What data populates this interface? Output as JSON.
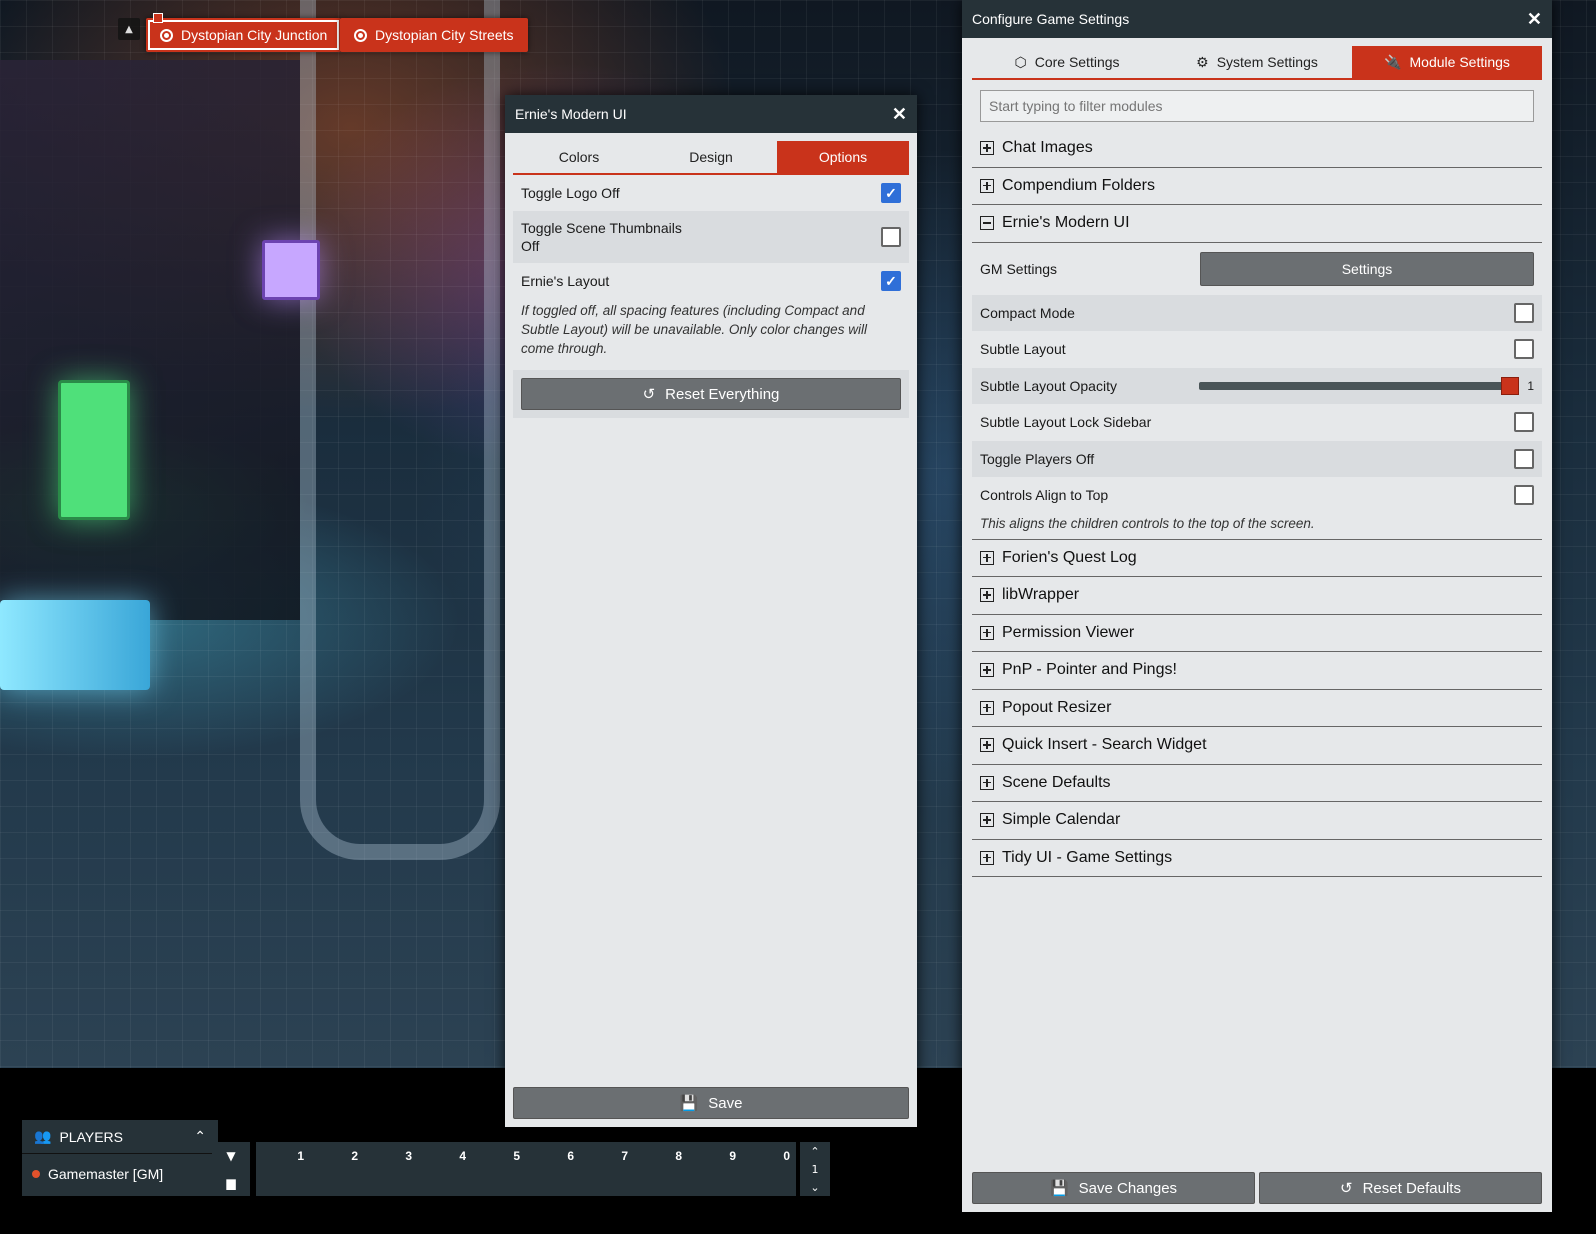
{
  "scene_nav": {
    "scenes": [
      {
        "label": "Dystopian City Junction",
        "active": true
      },
      {
        "label": "Dystopian City Streets",
        "active": false
      }
    ]
  },
  "ernie_window": {
    "title": "Ernie's Modern UI",
    "tabs": [
      {
        "label": "Colors",
        "active": false
      },
      {
        "label": "Design",
        "active": false
      },
      {
        "label": "Options",
        "active": true
      }
    ],
    "options": [
      {
        "label": "Toggle Logo Off",
        "checked": true
      },
      {
        "label": "Toggle Scene Thumbnails Off",
        "checked": false
      },
      {
        "label": "Ernie's Layout",
        "checked": true
      }
    ],
    "layout_hint": "If toggled off, all spacing features (including Compact and Subtle Layout) will be unavailable. Only color changes will come through.",
    "reset_label": "Reset Everything",
    "save_label": "Save"
  },
  "settings_window": {
    "title": "Configure Game Settings",
    "tabs": [
      {
        "label": "Core Settings",
        "icon": "d20-icon",
        "active": false
      },
      {
        "label": "System Settings",
        "icon": "gears-icon",
        "active": false
      },
      {
        "label": "Module Settings",
        "icon": "plug-icon",
        "active": true
      }
    ],
    "filter_placeholder": "Start typing to filter modules",
    "modules_before": [
      "Chat Images",
      "Compendium Folders"
    ],
    "expanded_module": "Ernie's Modern UI",
    "gm_settings_label": "GM Settings",
    "gm_settings_button": "Settings",
    "settings": [
      {
        "label": "Compact Mode",
        "checked": false
      },
      {
        "label": "Subtle Layout",
        "checked": false
      },
      {
        "label": "Subtle Layout Opacity",
        "value": "1"
      },
      {
        "label": "Subtle Layout Lock Sidebar",
        "checked": false
      },
      {
        "label": "Toggle Players Off",
        "checked": false
      },
      {
        "label": "Controls Align to Top",
        "checked": false
      }
    ],
    "controls_hint": "This aligns the children controls to the top of the screen.",
    "modules_after": [
      "Forien's Quest Log",
      "libWrapper",
      "Permission Viewer",
      "PnP - Pointer and Pings!",
      "Popout Resizer",
      "Quick Insert - Search Widget",
      "Scene Defaults",
      "Simple Calendar",
      "Tidy UI - Game Settings"
    ],
    "save_label": "Save Changes",
    "reset_label": "Reset Defaults"
  },
  "players": {
    "title": "PLAYERS",
    "list": [
      {
        "name": "Gamemaster [GM]",
        "color": "#e2522c"
      }
    ]
  },
  "hotbar": {
    "slots": [
      "1",
      "2",
      "3",
      "4",
      "5",
      "6",
      "7",
      "8",
      "9",
      "0"
    ],
    "page": "1"
  },
  "colors": {
    "accent": "#c9331b",
    "header": "#263238",
    "checkbox_checked": "#2f6fd8"
  }
}
